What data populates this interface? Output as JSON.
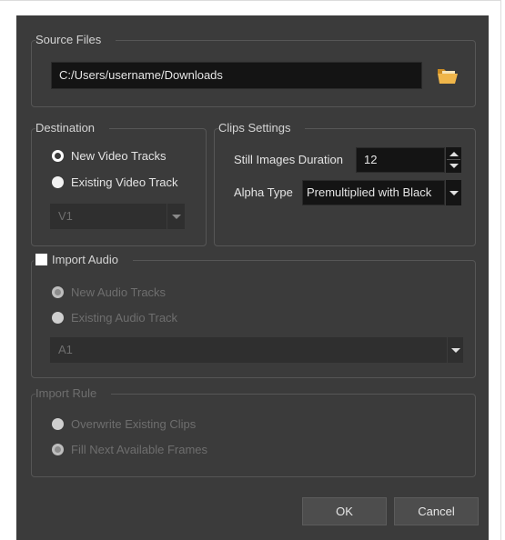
{
  "source_files": {
    "title": "Source Files",
    "path": "C:/Users/username/Downloads",
    "browse_icon": "folder-open-icon"
  },
  "destination": {
    "title": "Destination",
    "new_video_tracks": "New Video Tracks",
    "existing_video_track": "Existing Video Track",
    "track_value": "V1",
    "selected": "new_video_tracks"
  },
  "clips_settings": {
    "title": "Clips Settings",
    "still_images_duration_label": "Still Images Duration",
    "still_images_duration_value": "12",
    "alpha_type_label": "Alpha Type",
    "alpha_type_value": "Premultiplied with Black"
  },
  "import_audio": {
    "title": "Import Audio",
    "checked": false,
    "new_audio_tracks": "New Audio Tracks",
    "existing_audio_track": "Existing Audio Track",
    "track_value": "A1",
    "selected": "new_audio_tracks"
  },
  "import_rule": {
    "title": "Import Rule",
    "overwrite_existing_clips": "Overwrite Existing Clips",
    "fill_next_available_frames": "Fill Next Available Frames",
    "selected": "fill_next_available_frames"
  },
  "buttons": {
    "ok": "OK",
    "cancel": "Cancel"
  },
  "colors": {
    "dialog_bg": "#3b3b3b",
    "field_bg": "#141414",
    "folder_icon": "#f0b64a"
  }
}
